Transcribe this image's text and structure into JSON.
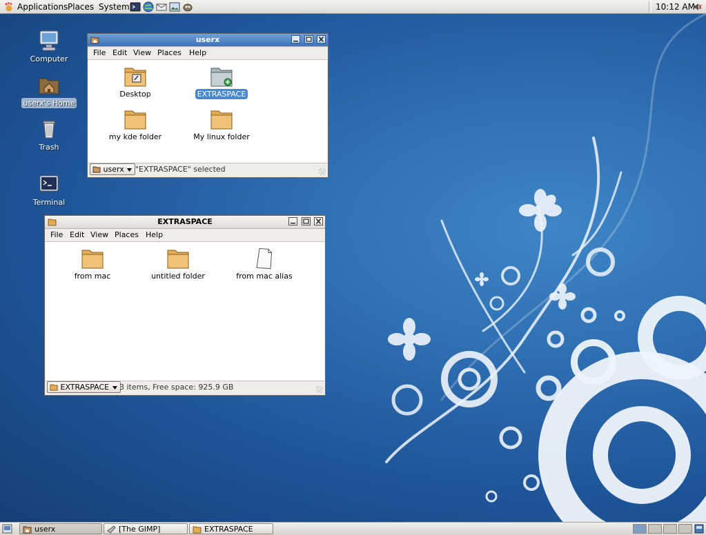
{
  "top_panel": {
    "menus": [
      "Applications",
      "Places",
      "System"
    ],
    "launchers": [
      "terminal-launcher-icon",
      "web-browser-launcher-icon",
      "email-launcher-icon",
      "image-viewer-launcher-icon",
      "gimp-launcher-icon"
    ],
    "clock": "10:12 AM",
    "volume_icon": "volume-icon"
  },
  "desktop_icons": [
    {
      "id": "computer",
      "label": "Computer",
      "icon": "computer-icon",
      "selected": false
    },
    {
      "id": "home",
      "label": "userx's Home",
      "icon": "home-folder-icon",
      "selected": true
    },
    {
      "id": "trash",
      "label": "Trash",
      "icon": "trash-icon",
      "selected": false
    },
    {
      "id": "terminal",
      "label": "Terminal",
      "icon": "terminal-icon",
      "selected": false
    }
  ],
  "windows": {
    "userx": {
      "title": "userx",
      "menus": [
        "File",
        "Edit",
        "View",
        "Places",
        "Help"
      ],
      "items": [
        {
          "label": "Desktop",
          "icon": "desktop-folder-icon",
          "selected": false
        },
        {
          "label": "EXTRASPACE",
          "icon": "network-drive-icon",
          "selected": true
        },
        {
          "label": "my kde folder",
          "icon": "folder-icon",
          "selected": false
        },
        {
          "label": "My linux folder",
          "icon": "folder-icon",
          "selected": false
        }
      ],
      "location": "userx",
      "status": "\"EXTRASPACE\" selected"
    },
    "extraspace": {
      "title": "EXTRASPACE",
      "menus": [
        "File",
        "Edit",
        "View",
        "Places",
        "Help"
      ],
      "items": [
        {
          "label": "from mac",
          "icon": "folder-icon",
          "selected": false
        },
        {
          "label": "untitled folder",
          "icon": "folder-icon",
          "selected": false
        },
        {
          "label": "from mac alias",
          "icon": "document-icon",
          "selected": false
        }
      ],
      "location": "EXTRASPACE",
      "status": "3 items, Free space: 925.9 GB"
    }
  },
  "taskbar": {
    "tasks": [
      {
        "label": "userx",
        "icon": "home-folder-icon",
        "active": true
      },
      {
        "label": "[The GIMP]",
        "icon": "gimp-icon",
        "active": false
      },
      {
        "label": "EXTRASPACE",
        "icon": "folder-icon",
        "active": false
      }
    ],
    "workspaces": 4,
    "current_workspace": 1
  },
  "colors": {
    "desktop_bg": "#2f70b2",
    "selection": "#4a88cf",
    "active_titlebar": "#3e73b7"
  }
}
